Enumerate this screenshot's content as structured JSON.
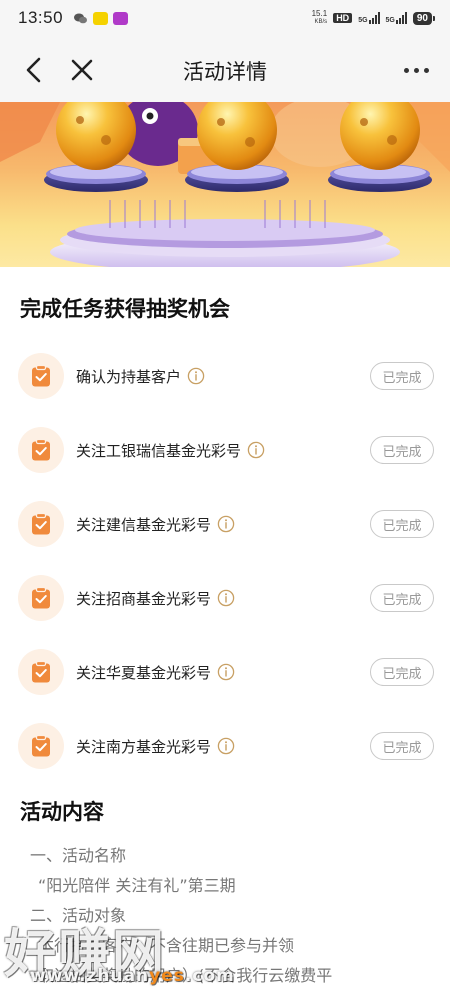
{
  "status_bar": {
    "time": "13:50",
    "net_speed": "15.1",
    "net_unit": "KB/s",
    "hd_label": "HD",
    "signal_label_1": "5G",
    "signal_label_2": "5G",
    "battery": "90"
  },
  "nav": {
    "title": "活动详情",
    "back_icon": "chevron-left-icon",
    "close_icon": "close-icon",
    "more_icon": "more-horizontal-icon"
  },
  "tasks_section": {
    "title": "完成任务获得抽奖机会",
    "items": [
      {
        "label": "确认为持基客户",
        "status": "已完成"
      },
      {
        "label": "关注工银瑞信基金光彩号",
        "status": "已完成"
      },
      {
        "label": "关注建信基金光彩号",
        "status": "已完成"
      },
      {
        "label": "关注招商基金光彩号",
        "status": "已完成"
      },
      {
        "label": "关注华夏基金光彩号",
        "status": "已完成"
      },
      {
        "label": "关注南方基金光彩号",
        "status": "已完成"
      }
    ]
  },
  "content_section": {
    "title": "活动内容",
    "lines": [
      "一、活动名称",
      "“阳光陪伴 关注有礼”第三期",
      "二、活动对象",
      "本行持基客户（不含往期已参与并领",
      "取过抽奖奖励的用户）(不含我行云缴费平"
    ]
  },
  "watermark": {
    "big": "好赚网",
    "small_prefix": "www.zhuan",
    "small_highlight": "yes",
    "small_suffix": ".com"
  },
  "colors": {
    "accent_orange": "#f08a3c",
    "task_icon_bg": "#fdf0e4",
    "done_border": "#c9c9c9",
    "done_text": "#999999",
    "info_icon": "#c8a064"
  }
}
